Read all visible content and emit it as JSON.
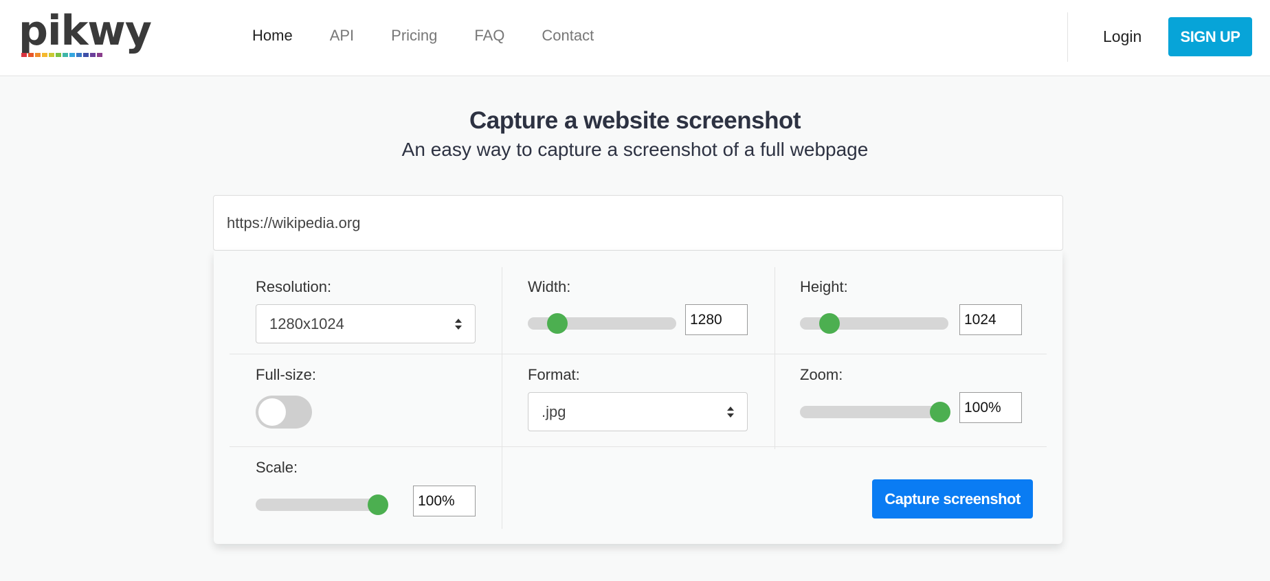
{
  "brand": {
    "logo_text": "pikwy",
    "logo_bar_colors": [
      "#d9333f",
      "#e8582a",
      "#f08c2a",
      "#f5b82e",
      "#c9c933",
      "#7cc141",
      "#3fb6a8",
      "#35a7e0",
      "#3a78c6",
      "#3f4fa8",
      "#6b3f9a",
      "#8a3d8c"
    ]
  },
  "nav": {
    "items": [
      {
        "label": "Home",
        "active": true
      },
      {
        "label": "API",
        "active": false
      },
      {
        "label": "Pricing",
        "active": false
      },
      {
        "label": "FAQ",
        "active": false
      },
      {
        "label": "Contact",
        "active": false
      }
    ],
    "login_label": "Login",
    "signup_label": "SIGN UP"
  },
  "hero": {
    "title": "Capture a website screenshot",
    "subtitle": "An easy way to capture a screenshot of a full webpage"
  },
  "url_input": {
    "value": "https://wikipedia.org"
  },
  "options": {
    "resolution": {
      "label": "Resolution:",
      "value": "1280x1024"
    },
    "width": {
      "label": "Width:",
      "value": "1280",
      "slider_fraction": 0.16
    },
    "height": {
      "label": "Height:",
      "value": "1024",
      "slider_fraction": 0.16
    },
    "fullsize": {
      "label": "Full-size:",
      "enabled": false
    },
    "format": {
      "label": "Format:",
      "value": ".jpg"
    },
    "zoom": {
      "label": "Zoom:",
      "value": "100%",
      "slider_fraction": 1.0
    },
    "scale": {
      "label": "Scale:",
      "value": "100%",
      "slider_fraction": 1.0
    }
  },
  "capture_label": "Capture screenshot",
  "colors": {
    "signup_bg": "#07a4d8",
    "capture_bg": "#0a7cf3",
    "slider_thumb": "#4caf50"
  }
}
